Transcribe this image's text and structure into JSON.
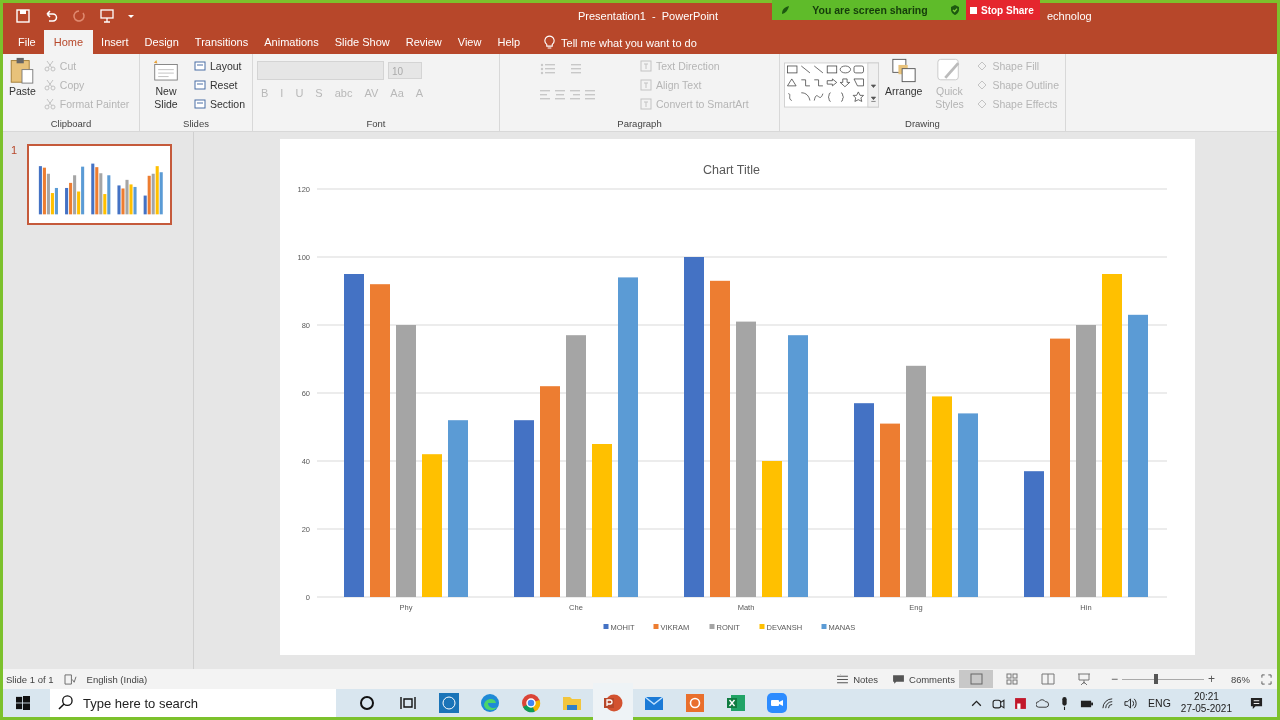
{
  "title_bar": {
    "title": "Presentation1  -  PowerPoint",
    "cut_text": "echnolog"
  },
  "share_banner": {
    "text": "You are screen sharing",
    "stop_button": "Stop Share"
  },
  "tabs": [
    {
      "label": "File",
      "selected": false
    },
    {
      "label": "Home",
      "selected": true
    },
    {
      "label": "Insert",
      "selected": false
    },
    {
      "label": "Design",
      "selected": false
    },
    {
      "label": "Transitions",
      "selected": false
    },
    {
      "label": "Animations",
      "selected": false
    },
    {
      "label": "Slide Show",
      "selected": false
    },
    {
      "label": "Review",
      "selected": false
    },
    {
      "label": "View",
      "selected": false
    },
    {
      "label": "Help",
      "selected": false
    }
  ],
  "tell_me": {
    "placeholder": "Tell me what you want to do"
  },
  "ribbon": {
    "clipboard": {
      "label": "Clipboard",
      "paste": "Paste",
      "commands": [
        {
          "label": "Cut",
          "disabled": true
        },
        {
          "label": "Copy",
          "disabled": true
        },
        {
          "label": "Format Painter",
          "disabled": true
        }
      ]
    },
    "slides": {
      "label": "Slides",
      "new_slide": "New Slide",
      "commands": [
        {
          "label": "Layout",
          "disabled": false
        },
        {
          "label": "Reset",
          "disabled": false
        },
        {
          "label": "Section",
          "disabled": false
        }
      ]
    },
    "font": {
      "label": "Font",
      "size": "10",
      "buttons": [
        {
          "label": "B",
          "disabled": true
        },
        {
          "label": "I",
          "disabled": true
        },
        {
          "label": "U",
          "disabled": true
        },
        {
          "label": "S",
          "disabled": true
        },
        {
          "label": "abc",
          "disabled": true
        },
        {
          "label": "AV",
          "disabled": true
        },
        {
          "label": "Aa",
          "disabled": true
        },
        {
          "label": "A",
          "disabled": true
        }
      ]
    },
    "paragraph": {
      "label": "Paragraph",
      "commands": [
        {
          "label": "Text Direction",
          "disabled": true
        },
        {
          "label": "Align Text",
          "disabled": true
        },
        {
          "label": "Convert to SmartArt",
          "disabled": true
        }
      ]
    },
    "drawing": {
      "label": "Drawing",
      "arrange": "Arrange",
      "quick_styles": {
        "label": "Quick Styles",
        "disabled": true
      },
      "commands": [
        {
          "label": "Shape Fill",
          "disabled": true
        },
        {
          "label": "Shape Outline",
          "disabled": true
        },
        {
          "label": "Shape Effects",
          "disabled": true
        }
      ]
    }
  },
  "thumbnails": [
    {
      "number": "1",
      "selected": true
    }
  ],
  "slide": {
    "chart_data": {
      "type": "bar",
      "title": "Chart Title",
      "grid": true,
      "legend": "bottom",
      "categories": [
        "Phy",
        "Che",
        "Math",
        "Eng",
        "Hin"
      ],
      "ylim": [
        0,
        120
      ],
      "yticks": [
        0,
        20,
        40,
        60,
        80,
        100,
        120
      ],
      "series": [
        {
          "name": "MOHIT",
          "color": "#4472c4",
          "values": [
            95,
            52,
            100,
            57,
            37
          ]
        },
        {
          "name": "VIKRAM",
          "color": "#ed7d31",
          "values": [
            92,
            62,
            93,
            51,
            76
          ]
        },
        {
          "name": "RONIT",
          "color": "#a5a5a5",
          "values": [
            80,
            77,
            81,
            68,
            80
          ]
        },
        {
          "name": "DEVANSH",
          "color": "#ffc000",
          "values": [
            42,
            45,
            40,
            59,
            95
          ]
        },
        {
          "name": "MANAS",
          "color": "#5b9bd5",
          "values": [
            52,
            94,
            77,
            54,
            83
          ]
        }
      ]
    }
  },
  "status_bar": {
    "slide": "Slide 1 of 1",
    "language": "English (India)",
    "notes": "Notes",
    "comments": "Comments",
    "zoom_out": "−",
    "zoom": {
      "level": 0.41
    },
    "zoom_in": "+",
    "zoom_label": "86%"
  },
  "taskbar": {
    "search": {
      "placeholder": "Type here to search"
    },
    "language": "ENG",
    "time": "20:21",
    "date": "27-05-2021"
  }
}
